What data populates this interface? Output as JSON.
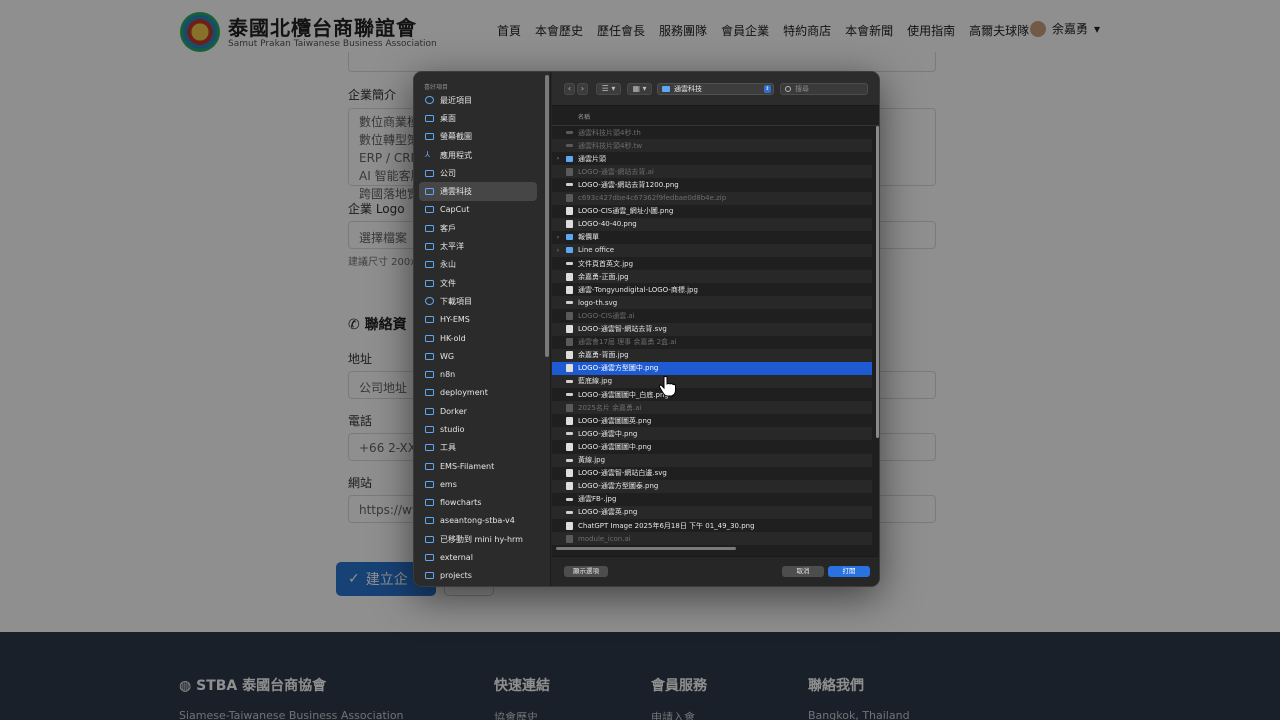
{
  "site": {
    "title": "泰國北欖台商聯誼會",
    "subtitle": "Samut Prakan Taiwanese Business Association",
    "nav": [
      "首頁",
      "本會歷史",
      "歷任會長",
      "服務團隊",
      "會員企業",
      "特約商店",
      "本會新聞",
      "使用指南",
      "高爾夫球隊"
    ],
    "user": "余嘉勇"
  },
  "form": {
    "intro_label": "企業簡介",
    "intro_lines": [
      "數位商業模",
      "數位轉型策",
      "ERP / CRM",
      "AI 智能客服",
      "跨國落地實"
    ],
    "logo_label": "企業 Logo",
    "file_button": "選擇檔案",
    "size_hint": "建議尺寸 200x",
    "contact_section": "聯絡資",
    "address_label": "地址",
    "address_placeholder": "公司地址",
    "phone_label": "電話",
    "phone_placeholder": "+66 2-XXX-",
    "website_label": "網站",
    "website_placeholder": "https://ww",
    "submit_label": "建立企"
  },
  "footer": {
    "brand": "STBA 泰國台商協會",
    "brand_sub": "Siamese-Taiwanese Business Association",
    "quick_links": "快速連結",
    "quick_link_1": "協會歷史",
    "member_services": "會員服務",
    "member_service_1": "申請入會",
    "contact": "聯絡我們",
    "contact_1": "Bangkok, Thailand"
  },
  "dialog": {
    "sidebar_heading": "喜好項目",
    "sidebar": [
      {
        "label": "最近項目",
        "icon": "clock-icon"
      },
      {
        "label": "桌面",
        "icon": "folder-icon"
      },
      {
        "label": "螢幕截圖",
        "icon": "folder-icon"
      },
      {
        "label": "應用程式",
        "icon": "apps-icon"
      },
      {
        "label": "公司",
        "icon": "folder-icon"
      },
      {
        "label": "通雲科技",
        "icon": "folder-icon",
        "selected": true
      },
      {
        "label": "CapCut",
        "icon": "folder-icon"
      },
      {
        "label": "客戶",
        "icon": "folder-icon"
      },
      {
        "label": "太平洋",
        "icon": "folder-icon"
      },
      {
        "label": "永山",
        "icon": "folder-icon"
      },
      {
        "label": "文件",
        "icon": "folder-icon"
      },
      {
        "label": "下載項目",
        "icon": "download-icon"
      },
      {
        "label": "HY-EMS",
        "icon": "folder-icon"
      },
      {
        "label": "HK-old",
        "icon": "folder-icon"
      },
      {
        "label": "WG",
        "icon": "folder-icon"
      },
      {
        "label": "n8n",
        "icon": "folder-icon"
      },
      {
        "label": "deployment",
        "icon": "folder-icon"
      },
      {
        "label": "Dorker",
        "icon": "folder-icon"
      },
      {
        "label": "studio",
        "icon": "folder-icon"
      },
      {
        "label": "工具",
        "icon": "folder-icon"
      },
      {
        "label": "EMS-Filament",
        "icon": "folder-icon"
      },
      {
        "label": "ems",
        "icon": "folder-icon"
      },
      {
        "label": "flowcharts",
        "icon": "folder-icon"
      },
      {
        "label": "aseantong-stba-v4",
        "icon": "folder-icon"
      },
      {
        "label": "已移動到 mini hy-hrm",
        "icon": "folder-icon"
      },
      {
        "label": "external",
        "icon": "folder-icon"
      },
      {
        "label": "projects",
        "icon": "folder-icon"
      }
    ],
    "current_folder": "通雲科技",
    "search_placeholder": "搜尋",
    "column_name": "名稱",
    "files": [
      {
        "name": "通雲科技片頭4秒.th",
        "type": "bar",
        "dim": true
      },
      {
        "name": "通雲科技片頭4秒.tw",
        "type": "bar",
        "dim": true
      },
      {
        "name": "通雲片頭",
        "type": "folder",
        "expandable": true
      },
      {
        "name": "LOGO-通雲-網站去背.ai",
        "type": "file",
        "dim": true
      },
      {
        "name": "LOGO-通雲-網站去背1200.png",
        "type": "bar"
      },
      {
        "name": "c693c427dbe4c67362f9fedbae0d8b4e.zip",
        "type": "file",
        "dim": true
      },
      {
        "name": "LOGO-CIS通雲_網址小圖.png",
        "type": "file"
      },
      {
        "name": "LOGO-40-40.png",
        "type": "file"
      },
      {
        "name": "報價單",
        "type": "folder",
        "expandable": true
      },
      {
        "name": "Line office",
        "type": "folder",
        "expandable": true
      },
      {
        "name": "文件頁首英文.jpg",
        "type": "bar"
      },
      {
        "name": "余嘉勇-正面.jpg",
        "type": "file"
      },
      {
        "name": "通雲-Tongyundigital-LOGO-商標.jpg",
        "type": "file"
      },
      {
        "name": "logo-th.svg",
        "type": "bar"
      },
      {
        "name": "LOGO-CIS通雲.ai",
        "type": "file",
        "dim": true
      },
      {
        "name": "LOGO-通雲智-網站去背.svg",
        "type": "file"
      },
      {
        "name": "通雲會17屆 理事 余嘉勇 2盒.ai",
        "type": "file",
        "dim": true
      },
      {
        "name": "余嘉勇-背面.jpg",
        "type": "file"
      },
      {
        "name": "LOGO-通雲方型圖中.png",
        "type": "file",
        "selected": true
      },
      {
        "name": "藍底線.jpg",
        "type": "bar"
      },
      {
        "name": "LOGO-通雲圖圖中_白底.png",
        "type": "bar"
      },
      {
        "name": "2025名片 余嘉勇.ai",
        "type": "file",
        "dim": true
      },
      {
        "name": "LOGO-通雲圖圖英.png",
        "type": "file"
      },
      {
        "name": "LOGO-通雲中.png",
        "type": "bar"
      },
      {
        "name": "LOGO-通雲圖圖中.png",
        "type": "file"
      },
      {
        "name": "黃線.jpg",
        "type": "bar"
      },
      {
        "name": "LOGO-通雲智-網站白邊.svg",
        "type": "file"
      },
      {
        "name": "LOGO-通雲方型圖泰.png",
        "type": "file"
      },
      {
        "name": "通雲FB-.jpg",
        "type": "bar"
      },
      {
        "name": "LOGO-通雲英.png",
        "type": "bar"
      },
      {
        "name": "ChatGPT Image 2025年6月18日 下午 01_49_30.png",
        "type": "file"
      },
      {
        "name": "module_icon.ai",
        "type": "file",
        "dim": true
      }
    ],
    "show_options": "顯示選項",
    "cancel": "取消",
    "open": "打開"
  },
  "colors": {
    "selection": "#1e5ad1",
    "primary_button": "#2a72e0",
    "folder_icon": "#5ea8f3",
    "footer_bg": "#2f3a49"
  }
}
